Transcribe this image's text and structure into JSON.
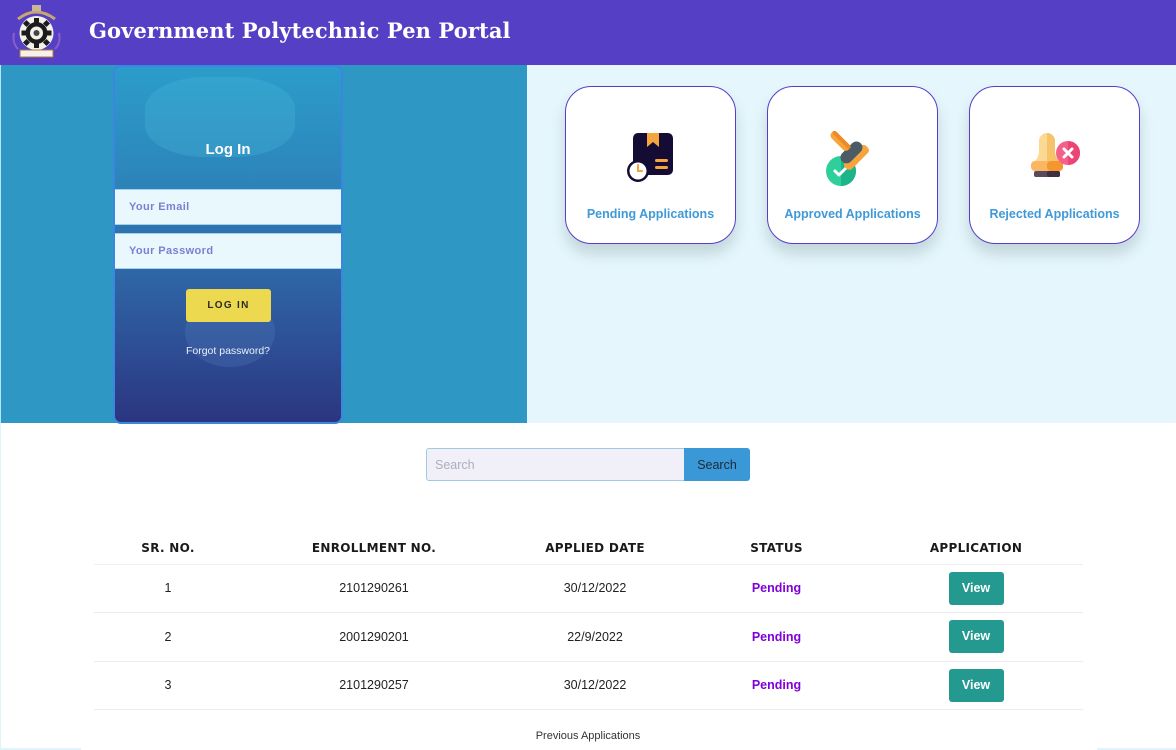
{
  "header": {
    "title": "Government Polytechnic Pen Portal",
    "logo": "college-emblem-gear-logo"
  },
  "login": {
    "title": "Log In",
    "email_placeholder": "Your Email",
    "password_placeholder": "Your Password",
    "login_button": "LOG IN",
    "forgot_password": "Forgot password?"
  },
  "dashboard": {
    "cards": [
      {
        "label": "Pending Applications",
        "icon": "pending-box-clock-icon"
      },
      {
        "label": "Approved Applications",
        "icon": "approved-stamp-check-icon"
      },
      {
        "label": "Rejected Applications",
        "icon": "rejected-stamp-x-icon"
      }
    ]
  },
  "search": {
    "placeholder": "Search",
    "value": "",
    "button": "Search"
  },
  "table": {
    "headers": [
      "SR. NO.",
      "ENROLLMENT NO.",
      "APPLIED DATE",
      "STATUS",
      "APPLICATION"
    ],
    "rows": [
      {
        "sr": "1",
        "enrollment": "2101290261",
        "date": "30/12/2022",
        "status": "Pending",
        "action": "View"
      },
      {
        "sr": "2",
        "enrollment": "2001290201",
        "date": "22/9/2022",
        "status": "Pending",
        "action": "View"
      },
      {
        "sr": "3",
        "enrollment": "2101290257",
        "date": "30/12/2022",
        "status": "Pending",
        "action": "View"
      }
    ]
  },
  "footer": {
    "previous_applications": "Previous Applications"
  },
  "colors": {
    "header_bg": "#5540c5",
    "hero_left_bg": "#2e97c4",
    "hero_right_bg": "#e5f7fc",
    "card_label": "#3f9ad7",
    "login_button": "#ecd94f",
    "search_button": "#3a98d6",
    "view_button": "#24998f",
    "status_pending": "#8100d8"
  }
}
